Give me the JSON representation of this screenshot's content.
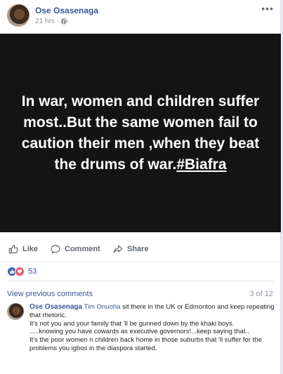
{
  "post": {
    "author": "Ose Osasenaga",
    "time": "21 hrs",
    "separator": "·",
    "more_label": "•••",
    "image_text": "In war, women and children suffer most..But the same women fail to caution their men ,when they beat the drums of war.",
    "image_hashtag": "#Biafra"
  },
  "actions": {
    "like": "Like",
    "comment": "Comment",
    "share": "Share"
  },
  "reactions": {
    "count": "53",
    "types": [
      "like-icon",
      "love-icon"
    ],
    "colors": {
      "like": "#4267b2",
      "love": "#f25268"
    }
  },
  "comments_section": {
    "view_previous": "View previous comments",
    "count_text": "3 of 12",
    "comment": {
      "author": "Ose Osasenaga",
      "mention": "Tim Onuoha",
      "lines": [
        " sit there in the UK or Edmonton and keep repeating that rhetoric.",
        "It's not you and your family that 'll be gunned down by the khaki boys.",
        ".....knowing you have cowards as executive governors!...keep saying that..",
        "It's the poor women n children back home in those suburbs that 'll suffer for the problems you igbos in the diaspora started."
      ]
    }
  },
  "colors": {
    "link": "#365899",
    "image_bg": "#141414",
    "muted": "#90949c"
  }
}
